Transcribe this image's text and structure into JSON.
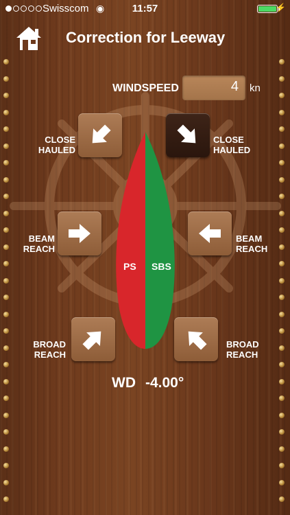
{
  "status_bar": {
    "carrier": "Swisscom",
    "time": "11:57",
    "battery_level": 1.0
  },
  "header": {
    "title": "Correction for Leeway",
    "home_icon": "home-icon"
  },
  "windspeed": {
    "label": "WINDSPEED",
    "value": "4",
    "unit": "kn"
  },
  "buttons": {
    "close_hauled_ps": {
      "label_line1": "CLOSE",
      "label_line2": "HAULED",
      "icon": "arrow-down-right-icon"
    },
    "close_hauled_sbs": {
      "label_line1": "CLOSE",
      "label_line2": "HAULED",
      "icon": "arrow-down-left-icon",
      "selected": true
    },
    "beam_reach_ps": {
      "label_line1": "BEAM",
      "label_line2": "REACH",
      "icon": "arrow-right-icon"
    },
    "beam_reach_sbs": {
      "label_line1": "BEAM",
      "label_line2": "REACH",
      "icon": "arrow-left-icon"
    },
    "broad_reach_ps": {
      "label_line1": "BROAD",
      "label_line2": "REACH",
      "icon": "arrow-up-right-icon"
    },
    "broad_reach_sbs": {
      "label_line1": "BROAD",
      "label_line2": "REACH",
      "icon": "arrow-up-left-icon"
    }
  },
  "boat": {
    "port_label": "PS",
    "starboard_label": "SBS",
    "port_color": "#d8262b",
    "starboard_color": "#1f9443"
  },
  "result": {
    "label": "WD",
    "value": "-4.00°"
  }
}
